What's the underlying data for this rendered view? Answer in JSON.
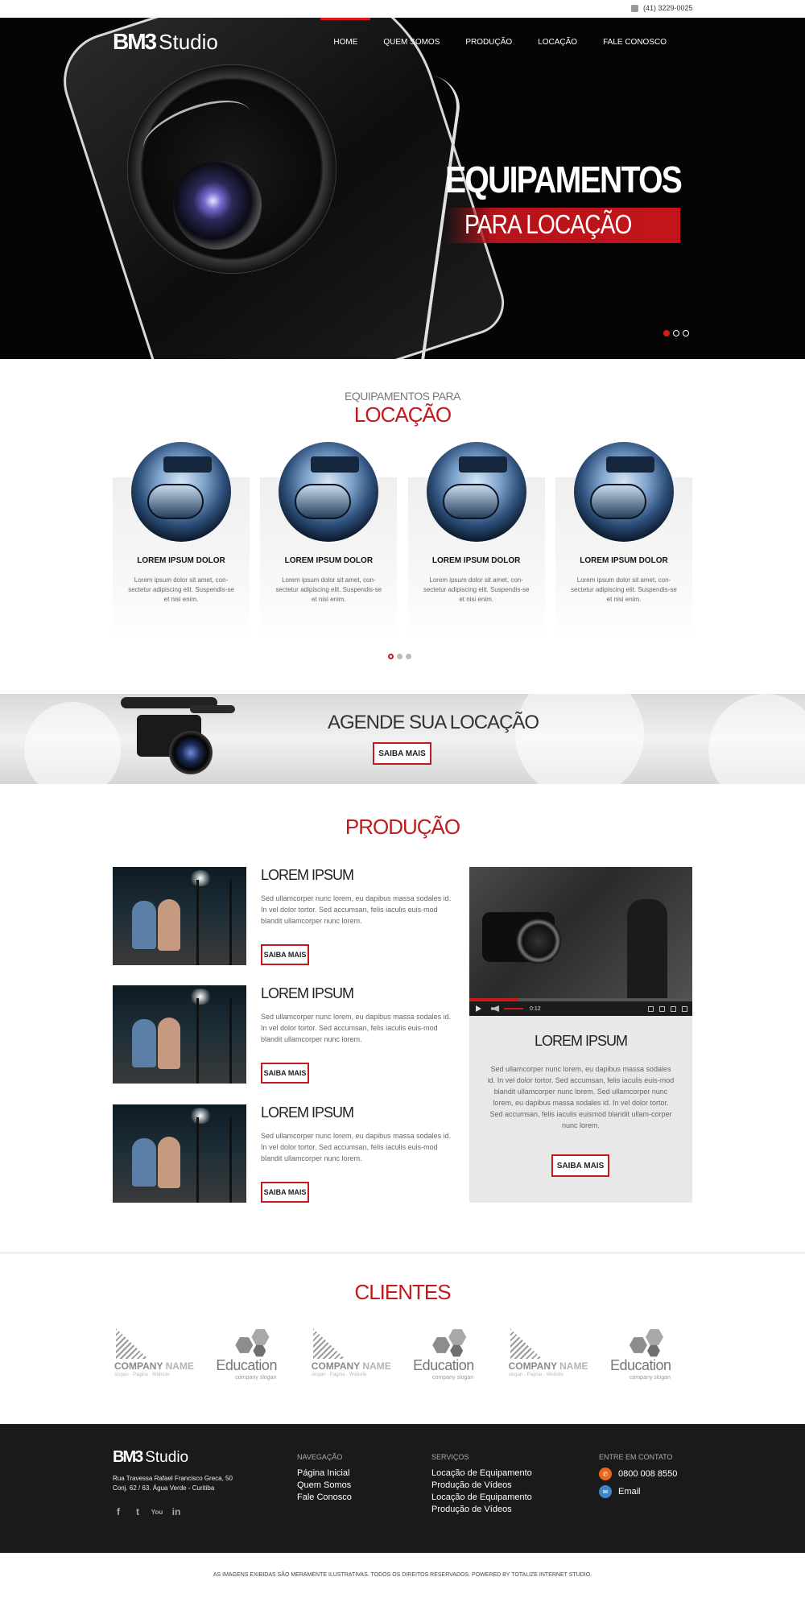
{
  "topbar": {
    "phone": "(41) 3229-0025"
  },
  "brand": {
    "bm": "BM",
    "three": "3",
    "studio": "Studio"
  },
  "nav": [
    {
      "label": "HOME",
      "active": true
    },
    {
      "label": "QUEM SOMOS",
      "active": false
    },
    {
      "label": "PRODUÇÃO",
      "active": false
    },
    {
      "label": "LOCAÇÃO",
      "active": false
    },
    {
      "label": "FALE CONOSCO",
      "active": false
    }
  ],
  "hero": {
    "title": "EQUIPAMENTOS",
    "subtitle": "PARA LOCAÇÃO",
    "slides": 3,
    "active_slide": 1
  },
  "equipment": {
    "small": "EQUIPAMENTOS PARA",
    "big": "LOCAÇÃO",
    "cards": [
      {
        "name": "LOREM IPSUM DOLOR",
        "desc": "Lorem ipsum dolor sit amet, con-sectetur adipiscing elit. Suspendis-se et nisi enim."
      },
      {
        "name": "LOREM IPSUM DOLOR",
        "desc": "Lorem ipsum dolor sit amet, con-sectetur adipiscing elit. Suspendis-se et nisi enim."
      },
      {
        "name": "LOREM IPSUM DOLOR",
        "desc": "Lorem ipsum dolor sit amet, con-sectetur adipiscing elit. Suspendis-se et nisi enim."
      },
      {
        "name": "LOREM IPSUM DOLOR",
        "desc": "Lorem ipsum dolor sit amet, con-sectetur adipiscing elit. Suspendis-se et nisi enim."
      }
    ]
  },
  "booking": {
    "title": "AGENDE SUA LOCAÇÃO",
    "button": "SAIBA MAIS"
  },
  "producao": {
    "title": "PRODUÇÃO",
    "items": [
      {
        "title": "LOREM IPSUM",
        "text": "Sed ullamcorper nunc lorem, eu dapibus massa sodales id. In vel dolor tortor. Sed accumsan, felis iaculis euis-mod blandit ullamcorper nunc lorem.",
        "button": "SAIBA MAIS"
      },
      {
        "title": "LOREM IPSUM",
        "text": "Sed ullamcorper nunc lorem, eu dapibus massa sodales id. In vel dolor tortor. Sed accumsan, felis iaculis euis-mod blandit ullamcorper nunc lorem.",
        "button": "SAIBA MAIS"
      },
      {
        "title": "LOREM IPSUM",
        "text": "Sed ullamcorper nunc lorem, eu dapibus massa sodales id. In vel dolor tortor. Sed accumsan, felis iaculis euis-mod blandit ullamcorper nunc lorem.",
        "button": "SAIBA MAIS"
      }
    ],
    "video": {
      "time": "0:12",
      "progress": 0.22,
      "title": "LOREM IPSUM",
      "text": "Sed ullamcorper nunc lorem, eu dapibus massa sodales id. In vel dolor tortor. Sed accumsan, felis iaculis euis-mod blandit ullamcorper nunc lorem. Sed ullamcorper nunc lorem, eu dapibus massa sodales id. In vel dolor tortor. Sed accumsan, felis iaculis euismod blandit ullam-corper nunc lorem.",
      "button": "SAIBA MAIS"
    }
  },
  "clients": {
    "title": "CLIENTES",
    "logos": [
      {
        "kind": "company",
        "name1": "COMPANY",
        "name2": "NAME",
        "slogan": "slogan · Pagina · Website"
      },
      {
        "kind": "education",
        "name": "Education",
        "slogan": "company slogan"
      },
      {
        "kind": "company",
        "name1": "COMPANY",
        "name2": "NAME",
        "slogan": "slogan · Pagina · Website"
      },
      {
        "kind": "education",
        "name": "Education",
        "slogan": "company slogan"
      },
      {
        "kind": "company",
        "name1": "COMPANY",
        "name2": "NAME",
        "slogan": "slogan · Pagina · Website"
      },
      {
        "kind": "education",
        "name": "Education",
        "slogan": "company slogan"
      }
    ]
  },
  "footer": {
    "address1": "Rua Travessa Rafael Francisco Greca, 50",
    "address2": "Conj. 62 / 63. Água Verde - Curitiba",
    "social": [
      "f",
      "t",
      "You",
      "in"
    ],
    "social_names": [
      "facebook-icon",
      "twitter-icon",
      "youtube-icon",
      "linkedin-icon"
    ],
    "nav_heading": "NAVEGAÇÃO",
    "nav_links": [
      "Página Inicial",
      "Quem Somos",
      "Fale Conosco"
    ],
    "services_heading": "SERVIÇOS",
    "services_links": [
      "Locação de Equipamento",
      "Produção de Vídeos",
      "Locação de Equipamento",
      "Produção de Vídeos"
    ],
    "contact_heading": "ENTRE EM CONTATO",
    "phone": "0800 008 8550",
    "email": "Email"
  },
  "legal": "AS IMAGENS EXIBIDAS SÃO MERAMENTE ILUSTRATIVAS. TODOS OS DIREITOS RESERVADOS. POWERED BY TOTALIZE INTERNET STUDIO.",
  "colors": {
    "accent": "#c11a1f",
    "footer_bg": "#1a1a1a",
    "phone_icon": "#e8671c",
    "email_icon": "#3a86c8"
  }
}
